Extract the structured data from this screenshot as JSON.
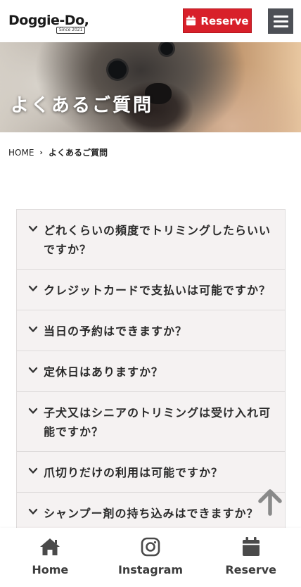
{
  "header": {
    "logo_text": "Doggie-Do,",
    "logo_tagline": "Since 2021",
    "reserve_label": "Reserve"
  },
  "hero": {
    "title": "よくあるご質問"
  },
  "breadcrumb": {
    "home": "HOME",
    "separator": "›",
    "current": "よくあるご質問"
  },
  "faq": {
    "items": [
      {
        "question": "どれくらいの頻度でトリミングしたらいいですか？"
      },
      {
        "question": "クレジットカードで支払いは可能ですか？"
      },
      {
        "question": "当日の予約はできますか？"
      },
      {
        "question": "定休日はありますか？"
      },
      {
        "question": "子犬又はシニアのトリミングは受け入れ可能ですか？"
      },
      {
        "question": "爪切りだけの利用は可能ですか？"
      },
      {
        "question": "シャンプー剤の持ち込みはできますか？"
      }
    ]
  },
  "bottom_nav": {
    "home_label": "Home",
    "instagram_label": "Instagram",
    "reserve_label": "Reserve"
  },
  "colors": {
    "reserve_red": "#d8202a",
    "menu_gray": "#4d5056",
    "faq_bg": "#f5f2f2",
    "icon_gray": "#4a4a4a"
  },
  "icons": [
    "calendar-icon",
    "hamburger-icon",
    "chevron-down-icon",
    "arrow-up-icon",
    "home-icon",
    "instagram-icon"
  ]
}
